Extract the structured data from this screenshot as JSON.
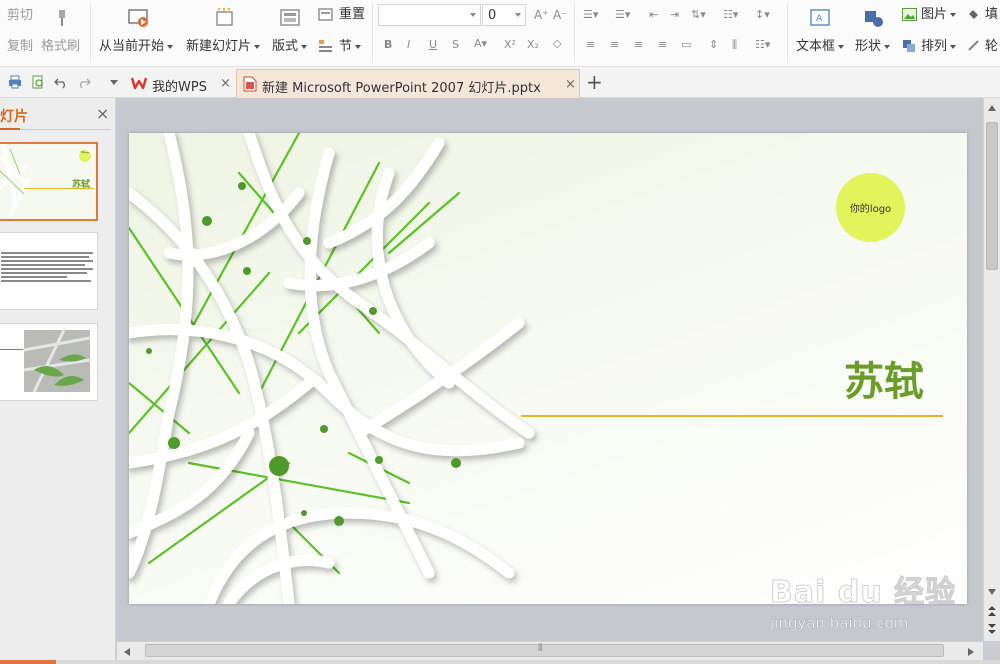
{
  "ribbon": {
    "clipboard": {
      "cut": "剪切",
      "copy": "复制",
      "format_painter": "格式刷"
    },
    "slides": {
      "from_current": "从当前开始",
      "new_slide": "新建幻灯片",
      "layout": "版式",
      "reset": "重置",
      "section": "节"
    },
    "font": {
      "font_name": "",
      "font_size": "0"
    },
    "drawing": {
      "textbox": "文本框",
      "shape": "形状",
      "picture": "图片",
      "fill": "填",
      "arrange": "排列",
      "outline": "轮"
    }
  },
  "tabs": [
    {
      "label": "我的WPS"
    },
    {
      "label": "新建 Microsoft PowerPoint 2007 幻灯片.pptx"
    }
  ],
  "new_tab_symbol": "+",
  "close_symbol": "×",
  "left_panel": {
    "title": "幻灯片",
    "thumb1_title": "苏轼",
    "thumb1_logo": "你的logo"
  },
  "slide": {
    "logo_text": "你的logo",
    "title": "苏轼"
  },
  "watermark": {
    "brand": "Bai du 经验",
    "url": "jingyan.baidu.com"
  },
  "colors": {
    "accent": "#6a9c2a",
    "logo_circle": "#e2f35c",
    "title_line": "#e4b52a",
    "active_tab": "#f5e6da",
    "wps_red": "#d9352b"
  }
}
